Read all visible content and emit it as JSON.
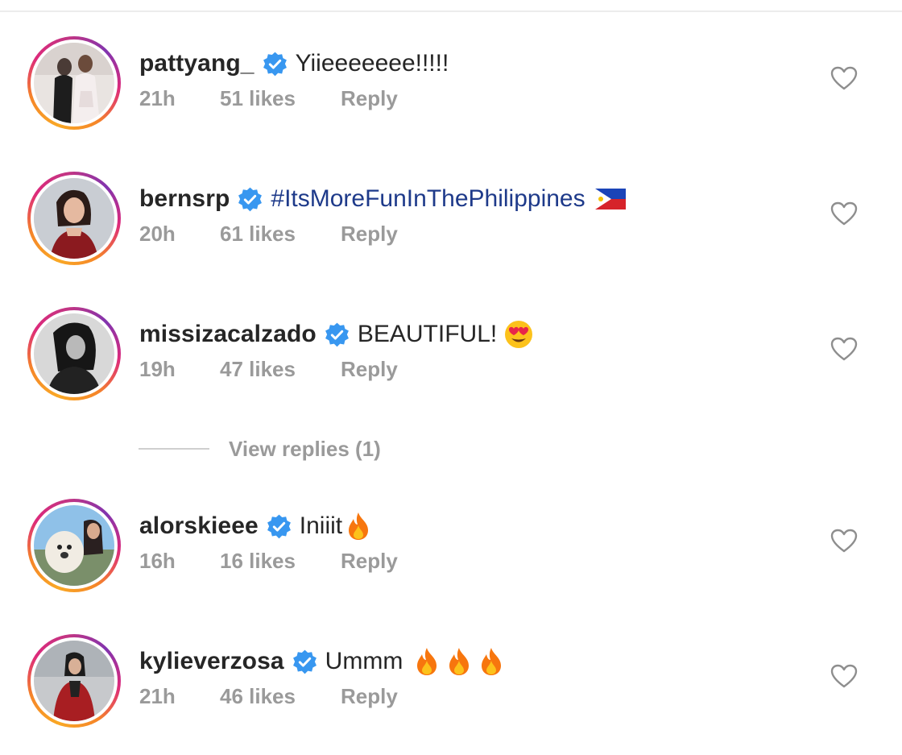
{
  "comments": [
    {
      "username": "pattyang_",
      "text": "Yiieeeeeee!!!!!",
      "time": "21h",
      "likes": "51 likes",
      "reply": "Reply",
      "avatar_icon": "photo-two-women"
    },
    {
      "username": "bernsrp",
      "text": "#ItsMoreFunInThePhilippines",
      "time": "20h",
      "likes": "61 likes",
      "reply": "Reply",
      "avatar_icon": "photo-woman-red-top",
      "trailing_icon": "philippines-flag"
    },
    {
      "username": "missizacalzado",
      "text": "BEAUTIFUL!",
      "time": "19h",
      "likes": "47 likes",
      "reply": "Reply",
      "avatar_icon": "photo-woman-bw",
      "trailing_icon": "heart-eyes-emoji"
    },
    {
      "username": "alorskieee",
      "text": "Iniiit",
      "time": "16h",
      "likes": "16 likes",
      "reply": "Reply",
      "avatar_icon": "photo-woman-with-dog",
      "trailing_icon": "fire-emoji"
    },
    {
      "username": "kylieverzosa",
      "text": "Ummm",
      "time": "21h",
      "likes": "46 likes",
      "reply": "Reply",
      "avatar_icon": "photo-woman-red-coat",
      "trailing_icon": "fire-emoji-x3"
    }
  ],
  "view_replies": "View replies (1)",
  "colors": {
    "verified_badge": "#3897f0",
    "secondary_text": "#9a9a9a",
    "primary_text": "#262626",
    "hashtag": "#1e3a8a",
    "story_ring_start": "#f9a825",
    "story_ring_end": "#c13584"
  }
}
